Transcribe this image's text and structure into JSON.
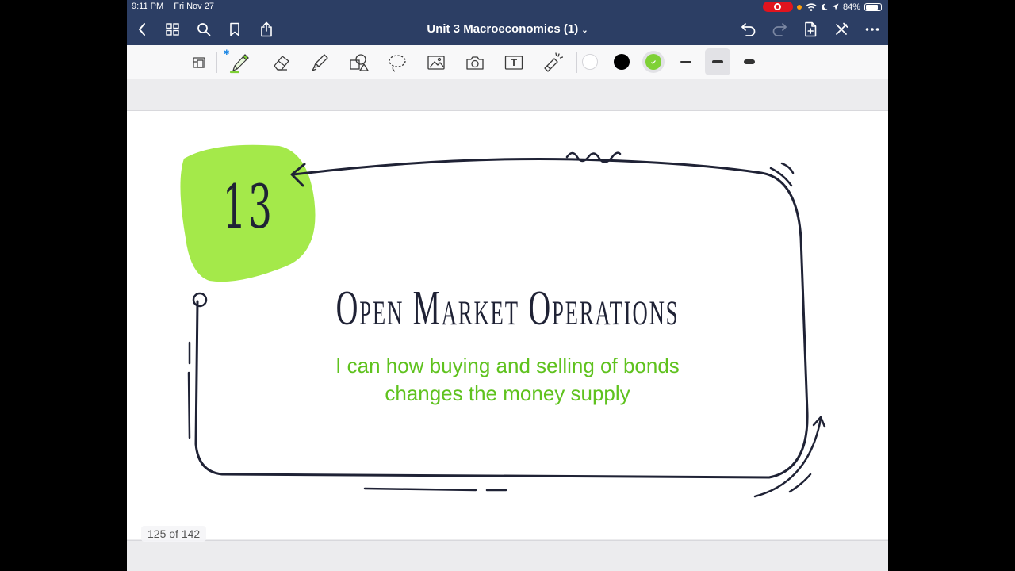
{
  "status_bar": {
    "time": "9:11 PM",
    "date": "Fri Nov 27",
    "battery_percent": "84%",
    "battery_level": 0.84
  },
  "nav_bar": {
    "document_title": "Unit 3 Macroeconomics (1)",
    "title_chevron": "⌄",
    "left_icons": [
      "back-icon",
      "grid-icon",
      "search-icon",
      "bookmark-icon",
      "share-icon"
    ],
    "right_icons": [
      "undo-icon",
      "redo-icon",
      "add-page-icon",
      "close-pen-icon",
      "more-icon"
    ]
  },
  "toolbar": {
    "tools": [
      "page-zoom-icon",
      "pen-icon",
      "eraser-icon",
      "highlighter-icon",
      "shapes-icon",
      "lasso-icon",
      "image-icon",
      "camera-icon",
      "text-icon",
      "laser-pointer-icon"
    ],
    "selected_tool": "pen",
    "bluetooth_glyph": "✱",
    "colors": [
      "#ffffff",
      "#000000",
      "#7fd136"
    ],
    "selected_color": "#7fd136",
    "stroke_widths": [
      "thin",
      "medium",
      "thick"
    ],
    "selected_stroke": "medium"
  },
  "slide": {
    "number": "13",
    "title": "Open Market Operations",
    "subtitle_line1": "I can how buying and selling of bonds",
    "subtitle_line2": "changes the money supply",
    "accent_color": "#a4e94a",
    "subtitle_color": "#5fc21e",
    "ink_color": "#1f2235"
  },
  "page_indicator": "125 of 142"
}
